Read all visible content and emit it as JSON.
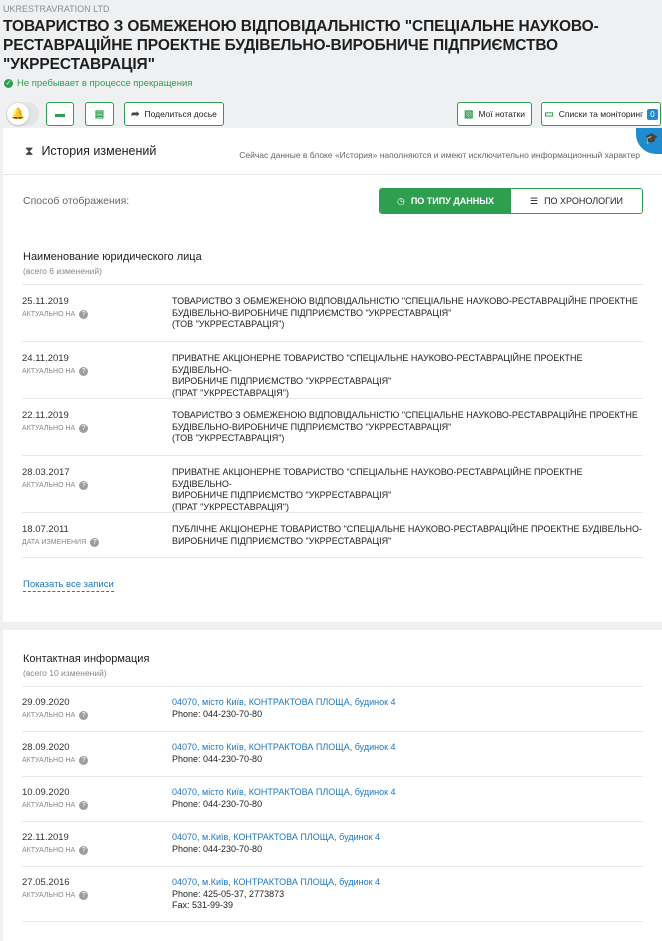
{
  "header": {
    "latin_name": "UKRESTRAVRATION LTD",
    "title": "ТОВАРИСТВО З ОБМЕЖЕНОЮ ВІДПОВІДАЛЬНІСТЮ \"СПЕЦІАЛЬНЕ НАУКОВО-РЕСТАВРАЦІЙНЕ ПРОЕКТНЕ БУДІВЕЛЬНО-ВИРОБНИЧЕ ПІДПРИЄМСТВО \"УКРРЕСТАВРАЦІЯ\"",
    "status": "Не пребывает в процессе прекращения",
    "status_icon": "check-icon",
    "status_color": "#2e9e4f"
  },
  "toolbar": {
    "share_label": "Поделиться досье",
    "notes_label": "Мої нотатки",
    "lists_label": "Списки та моніторинг",
    "lists_count": "0"
  },
  "history": {
    "title": "История изменений",
    "note": "Сейчас данные в блоке «История» наполняются и имеют исключительно информационный характер",
    "mode_label": "Способ отображения:",
    "mode_by_type": "ПО ТИПУ ДАННЫХ",
    "mode_by_time": "ПО ХРОНОЛОГИИ",
    "accent": "#2e9e4f"
  },
  "names_section": {
    "title": "Наименование юридического лица",
    "subtitle": "(всего 6 изменений)",
    "show_all": "Показать все записи",
    "rows": [
      {
        "date": "25.11.2019",
        "sub": "АКТУАЛЬНО НА",
        "line1": "ТОВАРИСТВО З ОБМЕЖЕНОЮ ВІДПОВІДАЛЬНІСТЮ \"СПЕЦІАЛЬНЕ НАУКОВО-РЕСТАВРАЦІЙНЕ ПРОЕКТНЕ",
        "line2": "БУДІВЕЛЬНО-ВИРОБНИЧЕ ПІДПРИЄМСТВО \"УКРРЕСТАВРАЦІЯ\"",
        "line3": "(ТОВ \"УКРРЕСТАВРАЦІЯ\")"
      },
      {
        "date": "24.11.2019",
        "sub": "АКТУАЛЬНО НА",
        "line1": "ПРИВАТНЕ АКЦІОНЕРНЕ ТОВАРИСТВО \"СПЕЦІАЛЬНЕ НАУКОВО-РЕСТАВРАЦІЙНЕ ПРОЕКТНЕ БУДІВЕЛЬНО-",
        "line2": "ВИРОБНИЧЕ ПІДПРИЄМСТВО \"УКРРЕСТАВРАЦІЯ\"",
        "line3": "(ПРАТ \"УКРРЕСТАВРАЦІЯ\")"
      },
      {
        "date": "22.11.2019",
        "sub": "АКТУАЛЬНО НА",
        "line1": "ТОВАРИСТВО З ОБМЕЖЕНОЮ ВІДПОВІДАЛЬНІСТЮ \"СПЕЦІАЛЬНЕ НАУКОВО-РЕСТАВРАЦІЙНЕ ПРОЕКТНЕ",
        "line2": "БУДІВЕЛЬНО-ВИРОБНИЧЕ ПІДПРИЄМСТВО \"УКРРЕСТАВРАЦІЯ\"",
        "line3": "(ТОВ \"УКРРЕСТАВРАЦІЯ\")"
      },
      {
        "date": "28.03.2017",
        "sub": "АКТУАЛЬНО НА",
        "line1": "ПРИВАТНЕ АКЦІОНЕРНЕ ТОВАРИСТВО \"СПЕЦІАЛЬНЕ НАУКОВО-РЕСТАВРАЦІЙНЕ ПРОЕКТНЕ БУДІВЕЛЬНО-",
        "line2": "ВИРОБНИЧЕ ПІДПРИЄМСТВО \"УКРРЕСТАВРАЦІЯ\"",
        "line3": "(ПРАТ \"УКРРЕСТАВРАЦІЯ\")"
      },
      {
        "date": "18.07.2011",
        "sub": "ДАТА ИЗМЕНЕНИЯ",
        "line1": "ПУБЛІЧНЕ АКЦІОНЕРНЕ ТОВАРИСТВО \"СПЕЦІАЛЬНЕ НАУКОВО-РЕСТАВРАЦІЙНЕ ПРОЕКТНЕ БУДІВЕЛЬНО-",
        "line2": "ВИРОБНИЧЕ ПІДПРИЄМСТВО \"УКРРЕСТАВРАЦІЯ\"",
        "line3": ""
      }
    ]
  },
  "contacts_section": {
    "title": "Контактная информация",
    "subtitle": "(всего 10 изменений)",
    "rows": [
      {
        "date": "29.09.2020",
        "sub": "АКТУАЛЬНО НА",
        "address": "04070, місто Київ, КОНТРАКТОВА ПЛОЩА, будинок 4",
        "phone": "Phone: 044-230-70-80",
        "fax": ""
      },
      {
        "date": "28.09.2020",
        "sub": "АКТУАЛЬНО НА",
        "address": "04070, місто Київ, КОНТРАКТОВА ПЛОЩА, будинок 4",
        "phone": "Phone: 044-230-70-80",
        "fax": ""
      },
      {
        "date": "10.09.2020",
        "sub": "АКТУАЛЬНО НА",
        "address": "04070, місто Київ, КОНТРАКТОВА ПЛОЩА, будинок 4",
        "phone": "Phone: 044-230-70-80",
        "fax": ""
      },
      {
        "date": "22.11.2019",
        "sub": "АКТУАЛЬНО НА",
        "address": "04070, м.Київ, КОНТРАКТОВА ПЛОЩА, будинок 4",
        "phone": "Phone: 044-230-70-80",
        "fax": ""
      },
      {
        "date": "27.05.2016",
        "sub": "АКТУАЛЬНО НА",
        "address": "04070, м.Київ, КОНТРАКТОВА ПЛОЩА, будинок 4",
        "phone": "Phone: 425-05-37, 2773873",
        "fax": "Fax: 531-99-39"
      }
    ]
  },
  "colors": {
    "accent_green": "#2e9e4f",
    "link_blue": "#1f77c0",
    "badge_blue": "#1f8ccf"
  }
}
